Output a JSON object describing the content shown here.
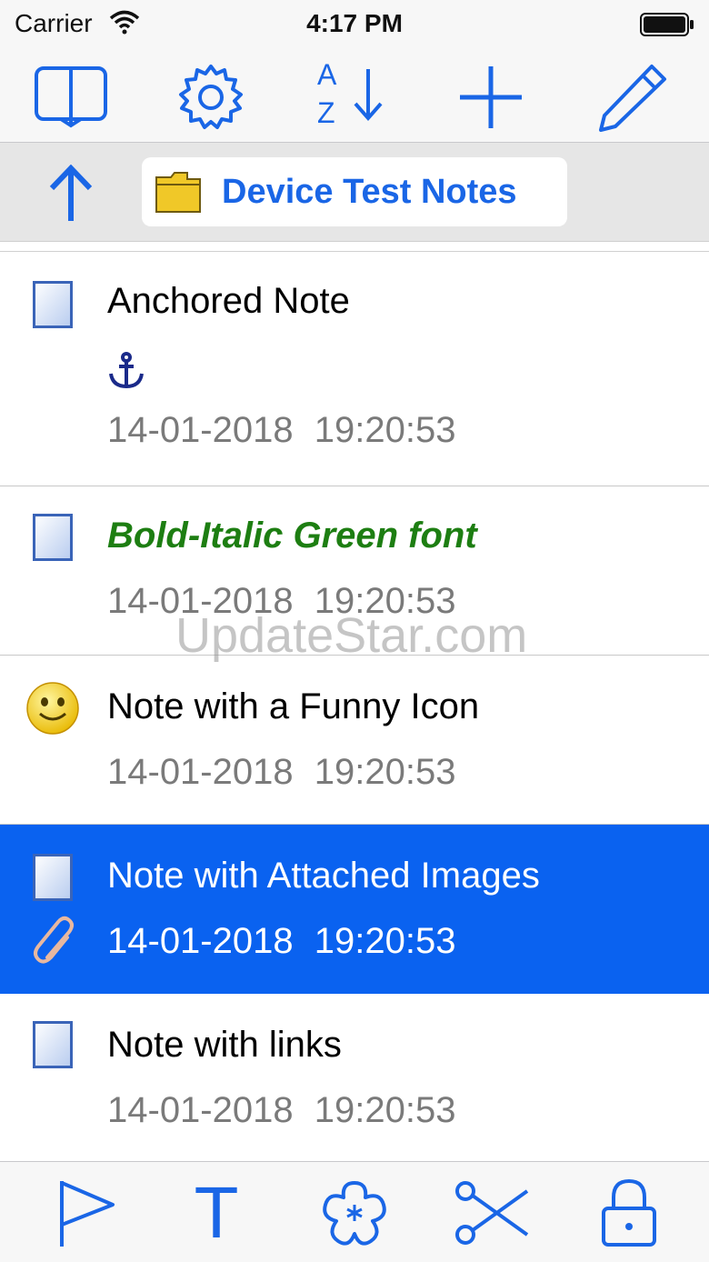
{
  "status_bar": {
    "carrier": "Carrier",
    "time": "4:17 PM"
  },
  "toolbar": {
    "buttons": [
      "book-icon",
      "gear-icon",
      "sort-az-icon",
      "plus-icon",
      "pencil-icon"
    ],
    "sort_letters": {
      "top": "A",
      "bottom": "Z"
    }
  },
  "path_bar": {
    "folder_name": "Device Test Notes"
  },
  "notes": [
    {
      "title": "Anchored Note",
      "date": "14-01-2018",
      "time": "19:20:53",
      "extra_icon": "anchor-icon"
    },
    {
      "title": "Bold-Italic Green font",
      "date": "14-01-2018",
      "time": "19:20:53"
    },
    {
      "title": "Note with a Funny Icon",
      "date": "14-01-2018",
      "time": "19:20:53",
      "icon": "smiley-icon"
    },
    {
      "title": "Note with Attached Images",
      "date": "14-01-2018",
      "time": "19:20:53",
      "selected": true,
      "extra_icon": "paperclip-icon"
    },
    {
      "title": "Note with links",
      "date": "14-01-2018",
      "time": "19:20:53"
    }
  ],
  "watermark": "UpdateStar.com",
  "bottom_bar": {
    "buttons": [
      "flag-icon",
      "text-icon",
      "flower-icon",
      "scissors-icon",
      "lock-icon"
    ],
    "text_glyph": "T"
  },
  "colors": {
    "accent": "#1a66e6",
    "selected": "#0a62f0",
    "green_font": "#1d7e12"
  }
}
